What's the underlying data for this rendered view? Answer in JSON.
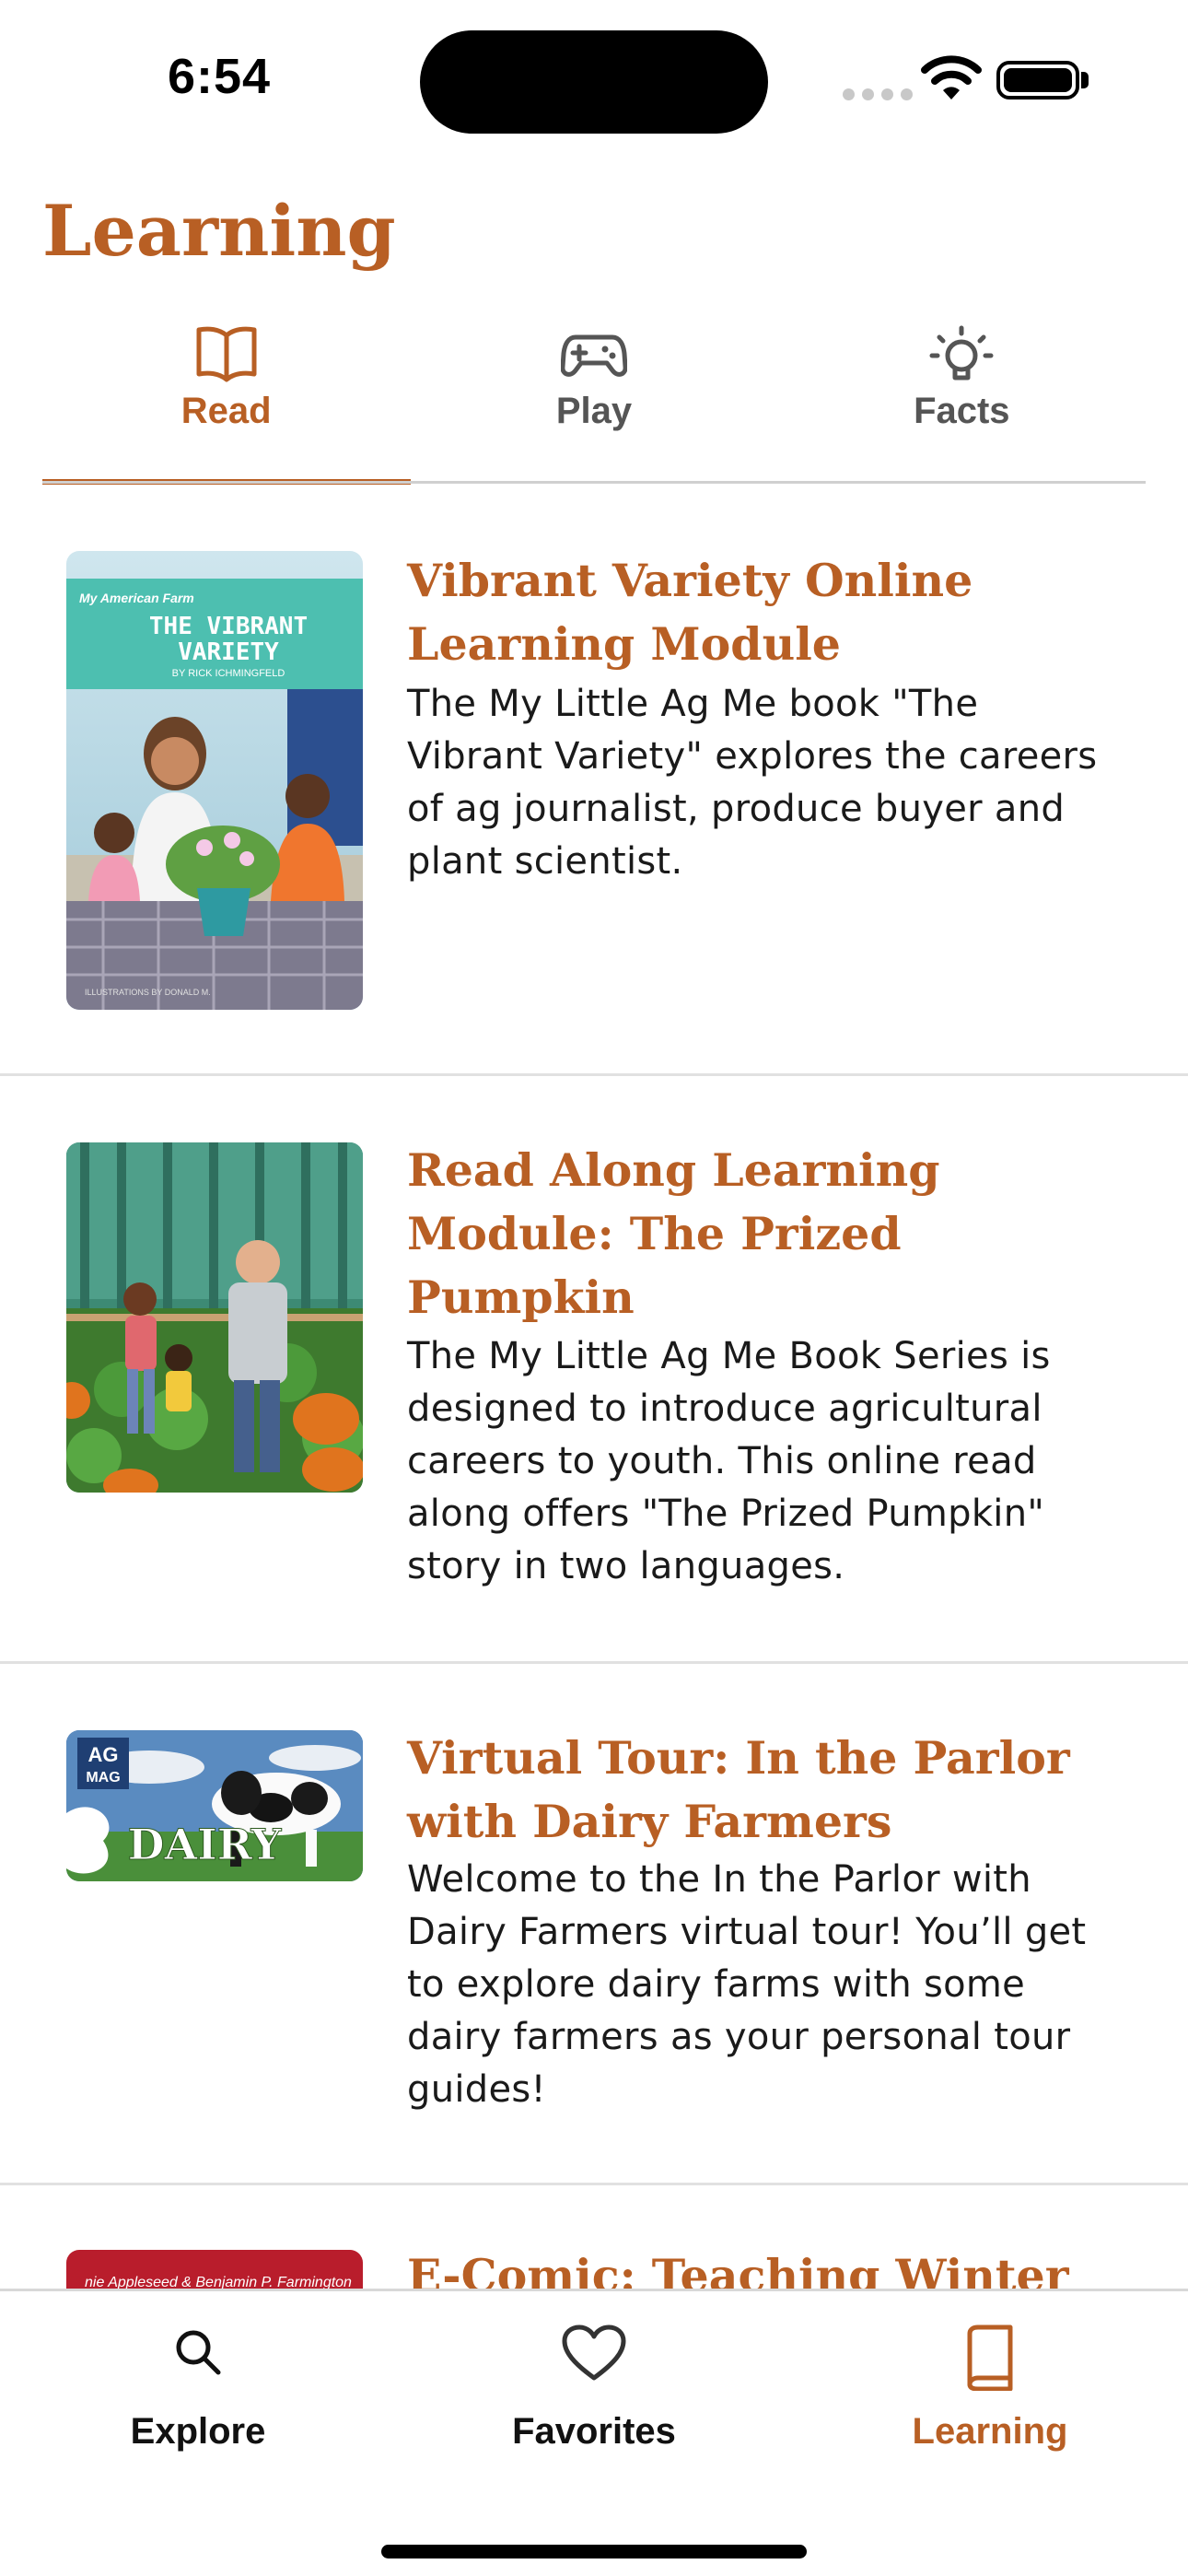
{
  "status_bar": {
    "time": "6:54"
  },
  "header": {
    "title": "Learning"
  },
  "tabs": [
    {
      "label": "Read",
      "icon": "book-open-icon",
      "active": true
    },
    {
      "label": "Play",
      "icon": "gamepad-icon",
      "active": false
    },
    {
      "label": "Facts",
      "icon": "lightbulb-icon",
      "active": false
    }
  ],
  "items": [
    {
      "title_lines": [
        "Vibrant Variety Online",
        "Learning Module"
      ],
      "desc_lines": [
        "The My Little Ag Me book \"The",
        "Vibrant Variety\" explores the careers",
        "of ag journalist, produce buyer and",
        "plant scientist."
      ],
      "thumb": {
        "brand": "My American Farm",
        "book_title_lines": [
          "THE VIBRANT",
          "VARIETY"
        ],
        "author": "BY RICK ICHMINGFELD",
        "illustrator": "ILLUSTRATIONS BY DONALD M."
      }
    },
    {
      "title_lines": [
        "Read Along Learning",
        "Module: The Prized",
        "Pumpkin"
      ],
      "desc_lines": [
        "The My Little Ag Me Book Series is",
        "designed to introduce agricultural",
        "careers to youth. This online read",
        "along offers \"The Prized Pumpkin\"",
        "story in two languages."
      ]
    },
    {
      "title_lines": [
        "Virtual Tour: In the Parlor",
        "with Dairy Farmers"
      ],
      "desc_lines": [
        "Welcome to the In the Parlor with",
        "Dairy Farmers virtual tour! You’ll get",
        "to explore dairy farms with some",
        "dairy farmers as your personal tour",
        "guides!"
      ],
      "thumb": {
        "badge_top": "AG",
        "badge_bottom": "MAG",
        "word": "DAIRY"
      }
    },
    {
      "title_lines": [
        "E-Comic: Teaching Winter"
      ],
      "thumb": {
        "text": "nie Appleseed & Benjamin P. Farmington"
      }
    }
  ],
  "bottom_nav": [
    {
      "label": "Explore",
      "icon": "search-icon",
      "active": false
    },
    {
      "label": "Favorites",
      "icon": "heart-icon",
      "active": false
    },
    {
      "label": "Learning",
      "icon": "book-icon",
      "active": true
    }
  ],
  "colors": {
    "accent": "#b85f24",
    "divider": "#e1e1e1"
  }
}
